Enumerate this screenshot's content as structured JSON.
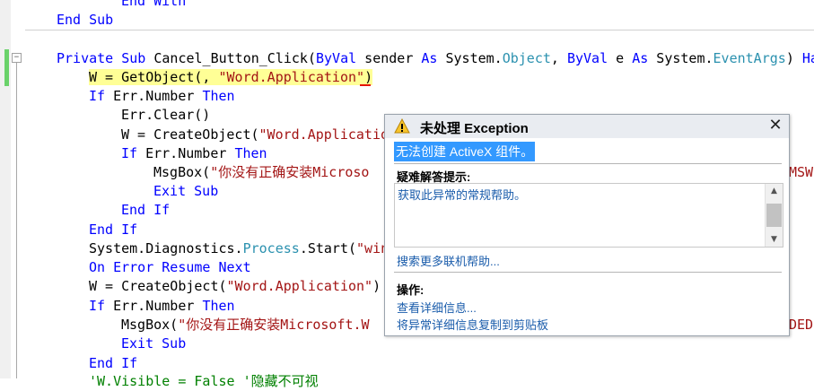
{
  "code": {
    "lines": [
      {
        "indent": 3,
        "parts": [
          {
            "t": "End With",
            "c": "kw"
          }
        ]
      },
      {
        "indent": 1,
        "parts": [
          {
            "t": "End Sub",
            "c": "kw"
          }
        ]
      },
      {
        "indent": 1,
        "parts": [
          {
            "t": "Private Sub",
            "c": "kw"
          },
          {
            "t": " Cancel_Button_Click(",
            "c": ""
          },
          {
            "t": "ByVal",
            "c": "kw"
          },
          {
            "t": " sender ",
            "c": ""
          },
          {
            "t": "As",
            "c": "kw"
          },
          {
            "t": " System.",
            "c": ""
          },
          {
            "t": "Object",
            "c": "ty"
          },
          {
            "t": ", ",
            "c": ""
          },
          {
            "t": "ByVal",
            "c": "kw"
          },
          {
            "t": " e ",
            "c": ""
          },
          {
            "t": "As",
            "c": "kw"
          },
          {
            "t": " System.",
            "c": ""
          },
          {
            "t": "EventArgs",
            "c": "ty"
          },
          {
            "t": ") ",
            "c": ""
          },
          {
            "t": "Ha",
            "c": "kw"
          }
        ]
      },
      {
        "indent": 2,
        "parts": [
          {
            "t": "W = GetObject(, ",
            "c": "hl"
          },
          {
            "t": "\"Word.Application\"",
            "c": "st hl"
          },
          {
            "t": ")",
            "c": "hl"
          }
        ]
      },
      {
        "indent": 2,
        "parts": [
          {
            "t": "If",
            "c": "kw"
          },
          {
            "t": " Err.Number ",
            "c": ""
          },
          {
            "t": "Then",
            "c": "kw"
          }
        ]
      },
      {
        "indent": 3,
        "parts": [
          {
            "t": "Err.Clear()",
            "c": ""
          }
        ]
      },
      {
        "indent": 3,
        "parts": [
          {
            "t": "W = CreateObject(",
            "c": ""
          },
          {
            "t": "\"Word.Applicatio",
            "c": "st"
          }
        ]
      },
      {
        "indent": 3,
        "parts": [
          {
            "t": "If",
            "c": "kw"
          },
          {
            "t": " Err.Number ",
            "c": ""
          },
          {
            "t": "Then",
            "c": "kw"
          }
        ]
      },
      {
        "indent": 4,
        "parts": [
          {
            "t": "MsgBox(",
            "c": ""
          },
          {
            "t": "\"你没有正确安装Microso",
            "c": "st"
          }
        ]
      },
      {
        "indent": 4,
        "parts": [
          {
            "t": "Exit Sub",
            "c": "kw"
          }
        ]
      },
      {
        "indent": 3,
        "parts": [
          {
            "t": "End If",
            "c": "kw"
          }
        ]
      },
      {
        "indent": 2,
        "parts": [
          {
            "t": "End If",
            "c": "kw"
          }
        ]
      },
      {
        "indent": 2,
        "parts": [
          {
            "t": "System.Diagnostics.",
            "c": ""
          },
          {
            "t": "Process",
            "c": "ty"
          },
          {
            "t": ".Start(",
            "c": ""
          },
          {
            "t": "\"win",
            "c": "st"
          }
        ]
      },
      {
        "indent": 2,
        "parts": [
          {
            "t": "On Error Resume Next",
            "c": "kw"
          }
        ]
      },
      {
        "indent": 2,
        "parts": [
          {
            "t": "W = CreateObject(",
            "c": ""
          },
          {
            "t": "\"Word.Application\"",
            "c": "st"
          },
          {
            "t": ")",
            "c": ""
          }
        ]
      },
      {
        "indent": 2,
        "parts": [
          {
            "t": "If",
            "c": "kw"
          },
          {
            "t": " Err.Number ",
            "c": ""
          },
          {
            "t": "Then",
            "c": "kw"
          }
        ]
      },
      {
        "indent": 3,
        "parts": [
          {
            "t": "MsgBox(",
            "c": ""
          },
          {
            "t": "\"你没有正确安装Microsoft.W",
            "c": "st"
          }
        ]
      },
      {
        "indent": 3,
        "parts": [
          {
            "t": "Exit Sub",
            "c": "kw"
          }
        ]
      },
      {
        "indent": 2,
        "parts": [
          {
            "t": "End If",
            "c": "kw"
          }
        ]
      },
      {
        "indent": 2,
        "parts": [
          {
            "t": "'W.Visible = False '隐藏不可视",
            "c": "cm"
          }
        ]
      }
    ],
    "right_fragments": {
      "line9": "MSW",
      "line17": "DED."
    }
  },
  "exception_popup": {
    "title": "未处理 Exception",
    "message": "无法创建 ActiveX 组件。",
    "tips_label": "疑难解答提示:",
    "tip_link": "获取此异常的常规帮助。",
    "search_link": "搜索更多联机帮助...",
    "actions_label": "操作:",
    "action_details": "查看详细信息...",
    "action_copy": "将异常详细信息复制到剪贴板"
  }
}
